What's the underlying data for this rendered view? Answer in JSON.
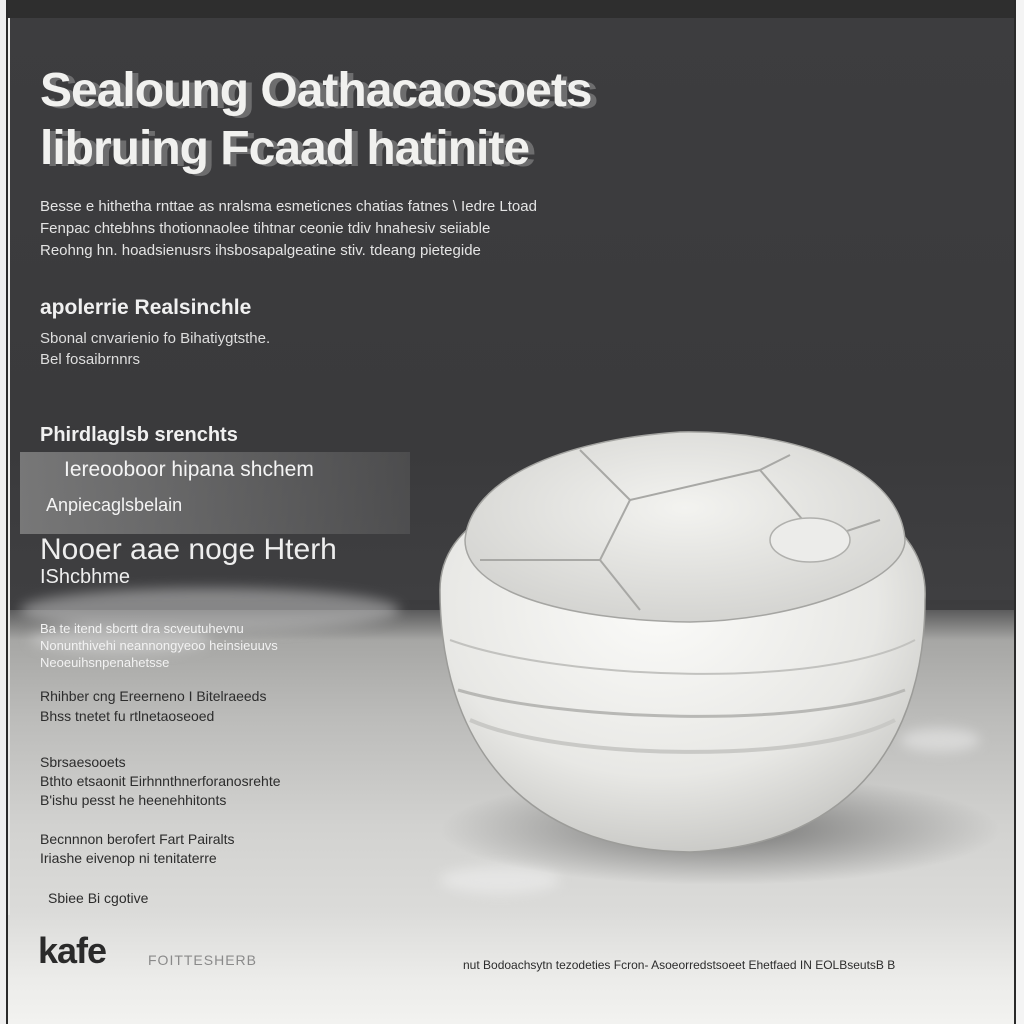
{
  "title": {
    "line1": "Sealoung Oathacaosoets",
    "line2": "libruing Fcaad hatinite"
  },
  "intro": [
    "Besse e hithetha rnttae as nralsma esmeticnes chatias fatnes \\ Iedre Ltoad",
    "Fenpac chtebhns thotionnaolee tihtnar ceonie tdiv hnahesiv seiiable",
    "Reohng hn. hoadsienusrs ihsbosapalgeatine stiv. tdeang pietegide"
  ],
  "section1": {
    "heading": "apolerrie Realsinchle",
    "body": [
      "Sbonal cnvarienio fo Bihatiygtsthe.",
      "Bel fosaibrnnrs"
    ]
  },
  "section2": {
    "heading": "Phirdlaglsb srenchts",
    "band_line1": "Iereooboor hipana shchem",
    "band_line2": "Anpiecaglsbelain"
  },
  "section3": {
    "line1": "Nooer aae noge Hterh",
    "line2": "IShcbhme"
  },
  "list1": [
    "Ba te itend sbcrtt dra scveutuhevnu",
    "Nonunthivehi neannongyeoo heinsieuuvs",
    "Neoeuihsnpenahetsse"
  ],
  "list2": [
    "Rhihber cng Ereerneno I Bitelraeeds",
    "Bhss tnetet fu rtlnetaoseoed"
  ],
  "list3": [
    "Sbrsaesooets",
    "Bthto etsaonit Eirhnnthnerforanosrehte",
    "B'ishu pesst he heenehhitonts"
  ],
  "list4": [
    "Becnnnon berofert Fart Pairalts",
    "Iriashe eivenop ni tenitaterre"
  ],
  "tiny_note": "Sbiee Bi cgotive",
  "brand": {
    "name": "kafe",
    "tagline": "FOITTESHERB"
  },
  "footer": "nut Bodoachsytn tezodeties Fcron- Asoeorredstsoeet Ehetfaed IN EOLBseutsB B",
  "colors": {
    "dark_panel": "#3b3b3d",
    "text_light": "#eeeeee",
    "text_dark": "#2a2a2a"
  }
}
